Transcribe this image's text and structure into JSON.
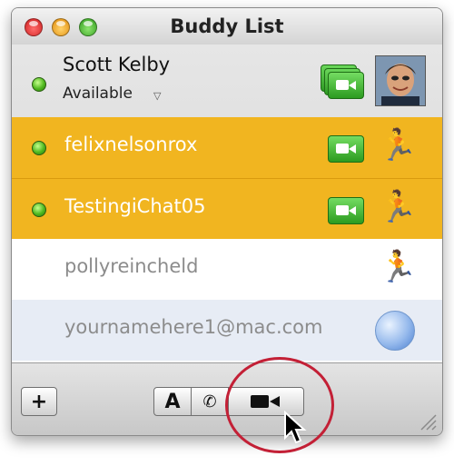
{
  "window": {
    "title": "Buddy List"
  },
  "me": {
    "name": "Scott Kelby",
    "status": "Available"
  },
  "buddies": [
    {
      "name": "felixnelsonrox",
      "service": "aim",
      "online": true,
      "video": true
    },
    {
      "name": "TestingiChat05",
      "service": "aim",
      "online": true,
      "video": true
    },
    {
      "name": "pollyreincheld",
      "service": "aim",
      "online": false,
      "video": false
    },
    {
      "name": "yournamehere1@mac.com",
      "service": "mac",
      "online": false,
      "video": false
    }
  ],
  "toolbar": {
    "add_label": "+",
    "text_chat_label": "A"
  },
  "colors": {
    "selected_row": "#f1b520",
    "mac_row": "#e7ecf5",
    "highlight_circle": "#c32036"
  },
  "icons": {
    "traffic_lights": [
      "close-icon",
      "minimize-icon",
      "zoom-icon"
    ],
    "audio": "phone-icon",
    "video": "video-camera-icon",
    "aim": "aim-running-man-icon",
    "mac": "dotmac-globe-icon"
  }
}
